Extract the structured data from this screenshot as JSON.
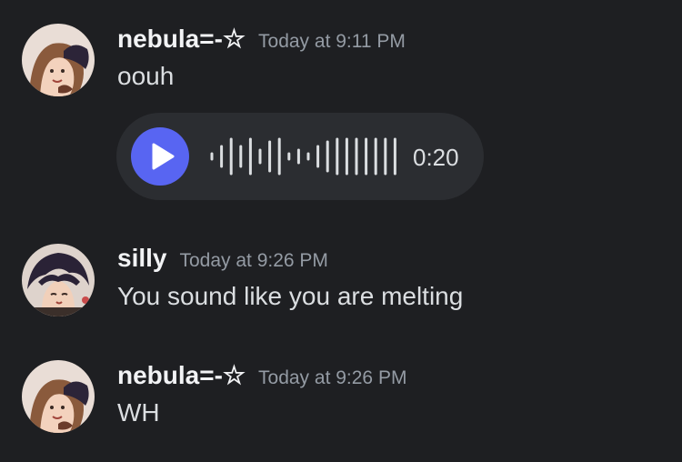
{
  "messages": [
    {
      "username": "nebula=-☆",
      "timestamp": "Today at 9:11 PM",
      "text": "oouh",
      "voice": {
        "duration": "0:20",
        "waveform": [
          0.15,
          0.55,
          0.95,
          0.55,
          0.95,
          0.35,
          0.8,
          0.95,
          0.15,
          0.35,
          0.15,
          0.55,
          0.8,
          0.95,
          0.95,
          0.95,
          0.95,
          0.95,
          0.95,
          0.95
        ],
        "accent_color": "#5865f2"
      }
    },
    {
      "username": "silly",
      "timestamp": "Today at 9:26 PM",
      "text": "You sound like you are melting"
    },
    {
      "username": "nebula=-☆",
      "timestamp": "Today at 9:26 PM",
      "text": "WH"
    }
  ]
}
